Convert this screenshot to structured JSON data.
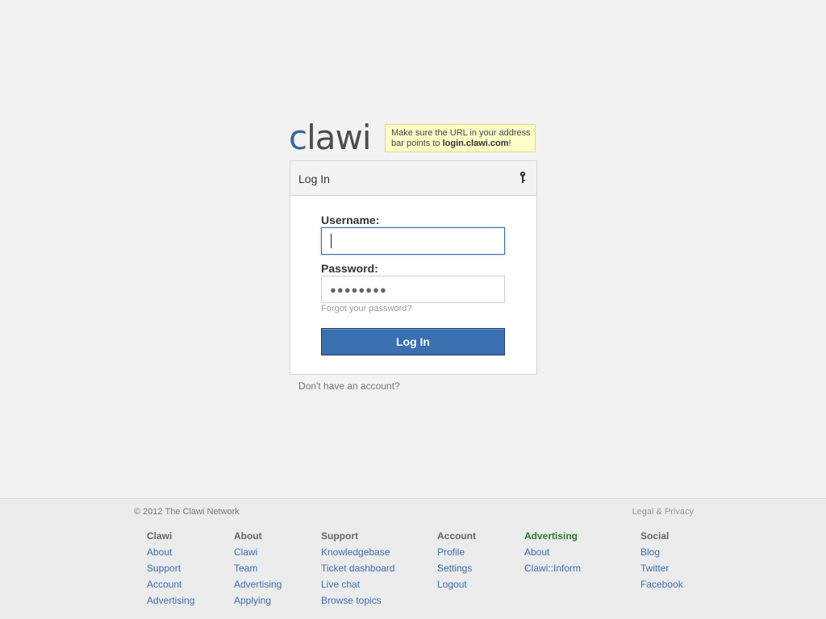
{
  "logo": {
    "text_c": "c",
    "text_rest": "lawi"
  },
  "notice": {
    "line1": "Make sure the URL in your address",
    "line2_prefix": "bar points to ",
    "domain": "login.clawi.com",
    "line2_suffix": "!"
  },
  "login": {
    "title": "Log In",
    "username_label": "Username:",
    "username_value": "",
    "password_label": "Password:",
    "password_value": "●●●●●●●●",
    "forgot_label": "Forgot your password?",
    "submit_label": "Log In"
  },
  "signup_label": "Don't have an account?",
  "footer": {
    "copyright": "© 2012 The Clawi Network",
    "legal": "Legal & Privacy",
    "columns": [
      {
        "heading": "Clawi",
        "highlight": false,
        "links": [
          "About",
          "Support",
          "Account",
          "Advertising"
        ]
      },
      {
        "heading": "About",
        "highlight": false,
        "links": [
          "Clawi",
          "Team",
          "Advertising",
          "Applying"
        ]
      },
      {
        "heading": "Support",
        "highlight": false,
        "links": [
          "Knowledgebase",
          "Ticket dashboard",
          "Live chat",
          "Browse topics"
        ]
      },
      {
        "heading": "Account",
        "highlight": false,
        "links": [
          "Profile",
          "Settings",
          "Logout"
        ]
      },
      {
        "heading": "Advertising",
        "highlight": true,
        "links": [
          "About",
          "Clawi::Inform"
        ]
      },
      {
        "heading": "Social",
        "highlight": false,
        "links": [
          "Blog",
          "Twitter",
          "Facebook"
        ]
      }
    ]
  },
  "colors": {
    "accent": "#3a6fb0",
    "notice_bg": "#fdfdc7",
    "highlight_heading": "#2a7a2a",
    "page_bg": "#f2f2f2"
  },
  "icons": {
    "panel_header": "key-icon"
  }
}
